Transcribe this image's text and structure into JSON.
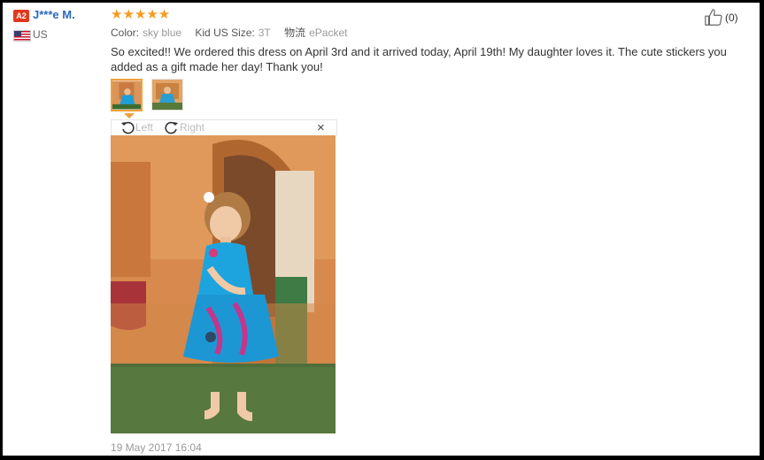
{
  "reviewer": {
    "level": "A2",
    "name": "J***e M.",
    "country": "US"
  },
  "rating": {
    "stars": "★★★★★",
    "value": 5
  },
  "attributes": [
    {
      "key": "Color:",
      "value": "sky blue"
    },
    {
      "key": "Kid US Size:",
      "value": "3T"
    },
    {
      "key": "物流",
      "value": "ePacket"
    }
  ],
  "review_text": "So excited!! We ordered this dress on April 3rd and it arrived today, April 19th! My daughter loves it. The cute stickers you added as a gift made her day! Thank you!",
  "like": {
    "count": "(0)",
    "icon": "thumbs-up-icon"
  },
  "viewer": {
    "rotate_left": "Left",
    "rotate_right": "Right",
    "close": "×"
  },
  "date": "19 May 2017 16:04",
  "colors": {
    "accent": "#f89a1b",
    "name": "#2a6bb8",
    "badge": "#e03a1e"
  }
}
